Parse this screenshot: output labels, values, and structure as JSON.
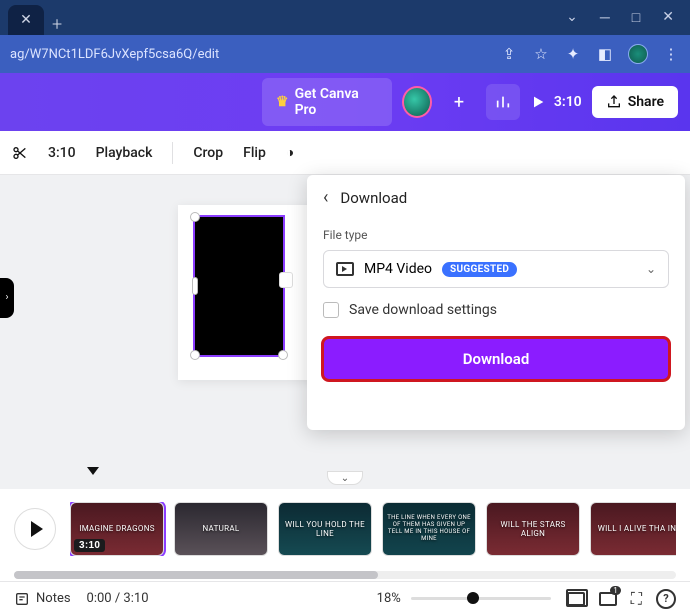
{
  "browser": {
    "url_fragment": "ag/W7NCt1LDF6JvXepf5csa6Q/edit"
  },
  "header": {
    "pro_label": "Get Canva Pro",
    "play_time": "3:10",
    "share_label": "Share"
  },
  "toolbar": {
    "duration": "3:10",
    "playback": "Playback",
    "crop": "Crop",
    "flip": "Flip"
  },
  "download_panel": {
    "title": "Download",
    "file_type_label": "File type",
    "file_type_value": "MP4 Video",
    "badge": "SUGGESTED",
    "save_settings_label": "Save download settings",
    "download_button": "Download"
  },
  "timeline": {
    "clips": [
      {
        "title": "IMAGINE DRAGONS",
        "duration": "3:10"
      },
      {
        "title": "NATURAL"
      },
      {
        "title": "WILL YOU HOLD THE LINE"
      },
      {
        "title": "THE LINE\nWHEN EVERY ONE OF THEM HAS GIVEN UP\nTELL ME\nIN THIS HOUSE OF MINE"
      },
      {
        "title": "WILL THE STARS ALIGN"
      },
      {
        "title": "WILL I\nALIVE THA\nIN"
      }
    ]
  },
  "bottombar": {
    "notes": "Notes",
    "time": "0:00 / 3:10",
    "zoom": "18%",
    "page_badge": "1"
  }
}
